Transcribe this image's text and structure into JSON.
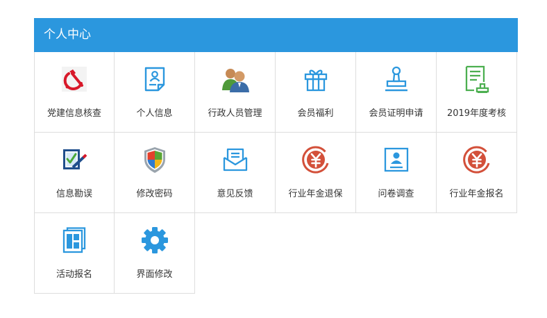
{
  "panel": {
    "title": "个人中心"
  },
  "items": [
    {
      "label": "党建信息核查",
      "icon": "party-emblem-icon"
    },
    {
      "label": "个人信息",
      "icon": "profile-document-icon"
    },
    {
      "label": "行政人员管理",
      "icon": "users-icon"
    },
    {
      "label": "会员福利",
      "icon": "gift-icon"
    },
    {
      "label": "会员证明申请",
      "icon": "stamp-icon"
    },
    {
      "label": "2019年度考核",
      "icon": "certificate-icon"
    },
    {
      "label": "信息勘误",
      "icon": "edit-checkbox-icon"
    },
    {
      "label": "修改密码",
      "icon": "security-shield-icon"
    },
    {
      "label": "意见反馈",
      "icon": "feedback-mail-icon"
    },
    {
      "label": "行业年金退保",
      "icon": "yuan-coin-icon"
    },
    {
      "label": "问卷调查",
      "icon": "survey-card-icon"
    },
    {
      "label": "行业年金报名",
      "icon": "yuan-coin-icon"
    },
    {
      "label": "活动报名",
      "icon": "activity-layout-icon"
    },
    {
      "label": "界面修改",
      "icon": "gear-icon"
    }
  ],
  "colors": {
    "header": "#2b97de",
    "icon_blue": "#2b97de",
    "icon_red": "#d3503a",
    "icon_green": "#4caf50",
    "emblem_red": "#d8192a",
    "text": "#333333",
    "border": "#dddddd"
  }
}
